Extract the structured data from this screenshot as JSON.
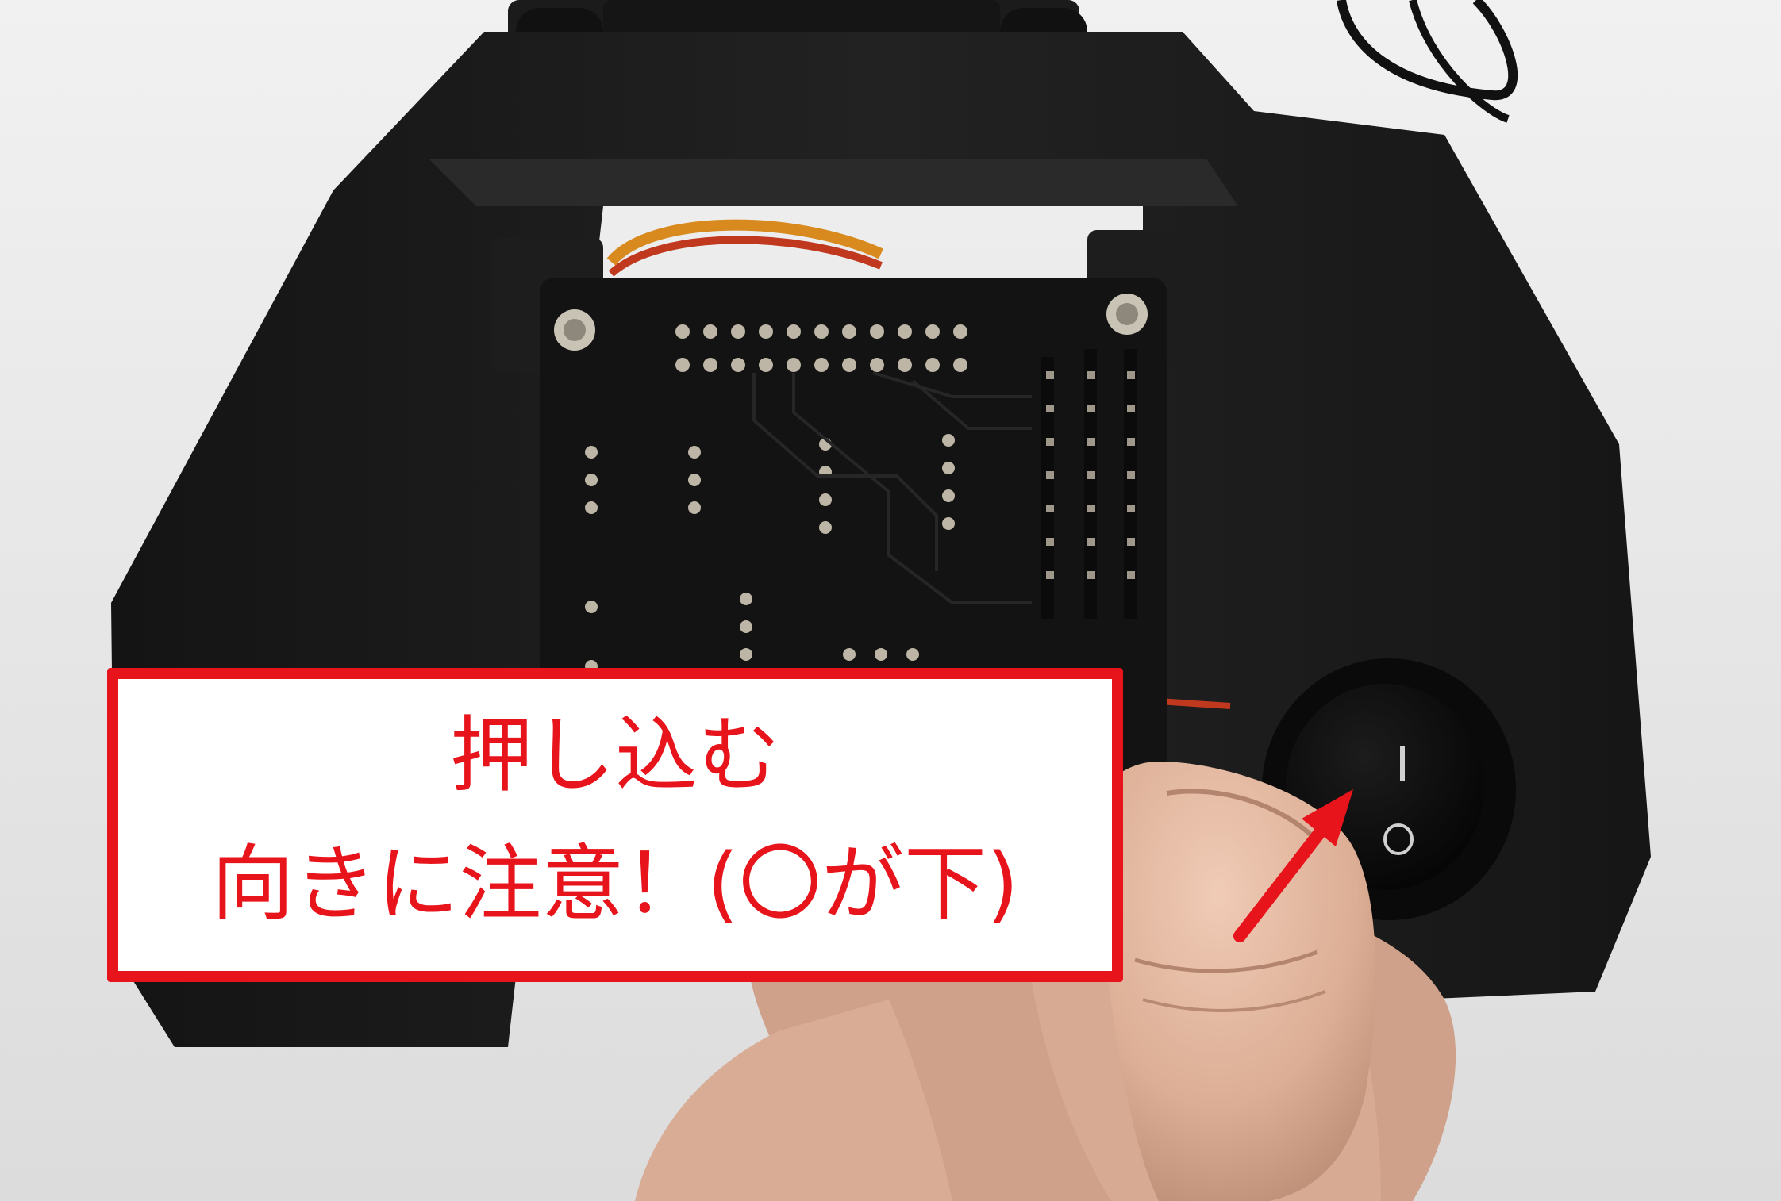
{
  "photo": {
    "subject": "black 3D-printed robot base with PCB and rocker power switch held by a finger",
    "colors": {
      "background": "#e9e9e9",
      "housing": "#1a1a1a",
      "pcb": "#141414",
      "pad": "#bdb6a6",
      "skin": "#e2b8a2",
      "switch": "#0c0c0c"
    },
    "switch_marks": {
      "on": "I",
      "off": "O"
    }
  },
  "callout": {
    "line1": "押し込む",
    "line2": "向きに注意！(〇が下)",
    "color": "#e8141c",
    "background": "#ffffff"
  },
  "arrow": {
    "color": "#e8141c",
    "target": "power-switch"
  }
}
